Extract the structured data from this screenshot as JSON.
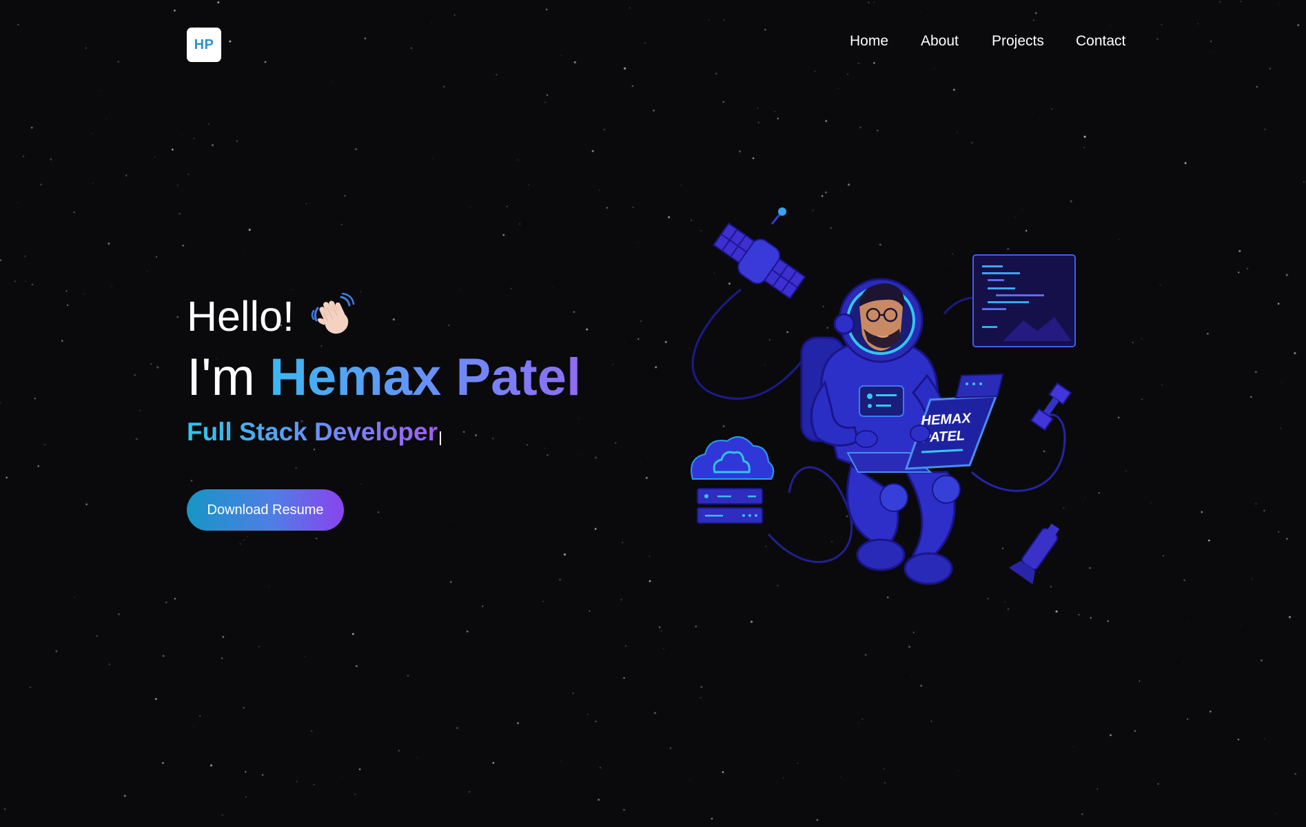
{
  "header": {
    "logo_text": "HP",
    "nav": {
      "home": "Home",
      "about": "About",
      "projects": "Projects",
      "contact": "Contact"
    }
  },
  "hero": {
    "greeting": "Hello!",
    "intro_prefix": "I'm",
    "name": "Hemax Patel",
    "role": "Full Stack Developer",
    "cta_label": "Download Resume"
  },
  "illustration": {
    "laptop_line1": "HEMAX",
    "laptop_line2": "PATEL"
  },
  "colors": {
    "background": "#0a0a0d",
    "accent_cyan": "#3cb8f2",
    "accent_purple": "#8f6cf5",
    "illustration_blue": "#2b2fc4"
  },
  "icons": {
    "wave": "waving-hand-icon",
    "cloud": "cloud-icon",
    "satellite": "satellite-icon"
  }
}
